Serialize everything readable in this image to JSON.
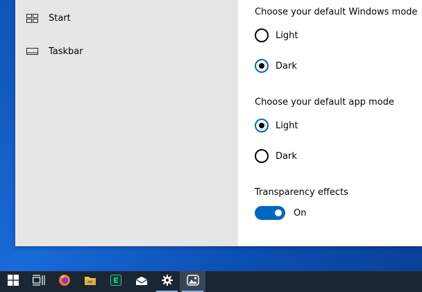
{
  "sidebar": {
    "items": [
      {
        "label": "Start",
        "icon": "start-layout-icon"
      },
      {
        "label": "Taskbar",
        "icon": "taskbar-icon"
      }
    ]
  },
  "windows_mode": {
    "title": "Choose your default Windows mode",
    "options": [
      {
        "label": "Light",
        "checked": false
      },
      {
        "label": "Dark",
        "checked": true
      }
    ]
  },
  "app_mode": {
    "title": "Choose your default app mode",
    "options": [
      {
        "label": "Light",
        "checked": true
      },
      {
        "label": "Dark",
        "checked": false
      }
    ]
  },
  "transparency": {
    "title": "Transparency effects",
    "state_label": "On",
    "enabled": true
  },
  "colors": {
    "accent": "#0067c0",
    "sidebar_bg": "#e6e6e6",
    "taskbar_bg": "#1b2633"
  },
  "taskbar": {
    "items": [
      "windows-start-icon",
      "task-view-icon",
      "firefox-icon",
      "file-explorer-icon",
      "terminal-app-icon",
      "mail-icon",
      "settings-gear-icon",
      "photos-app-icon"
    ]
  }
}
